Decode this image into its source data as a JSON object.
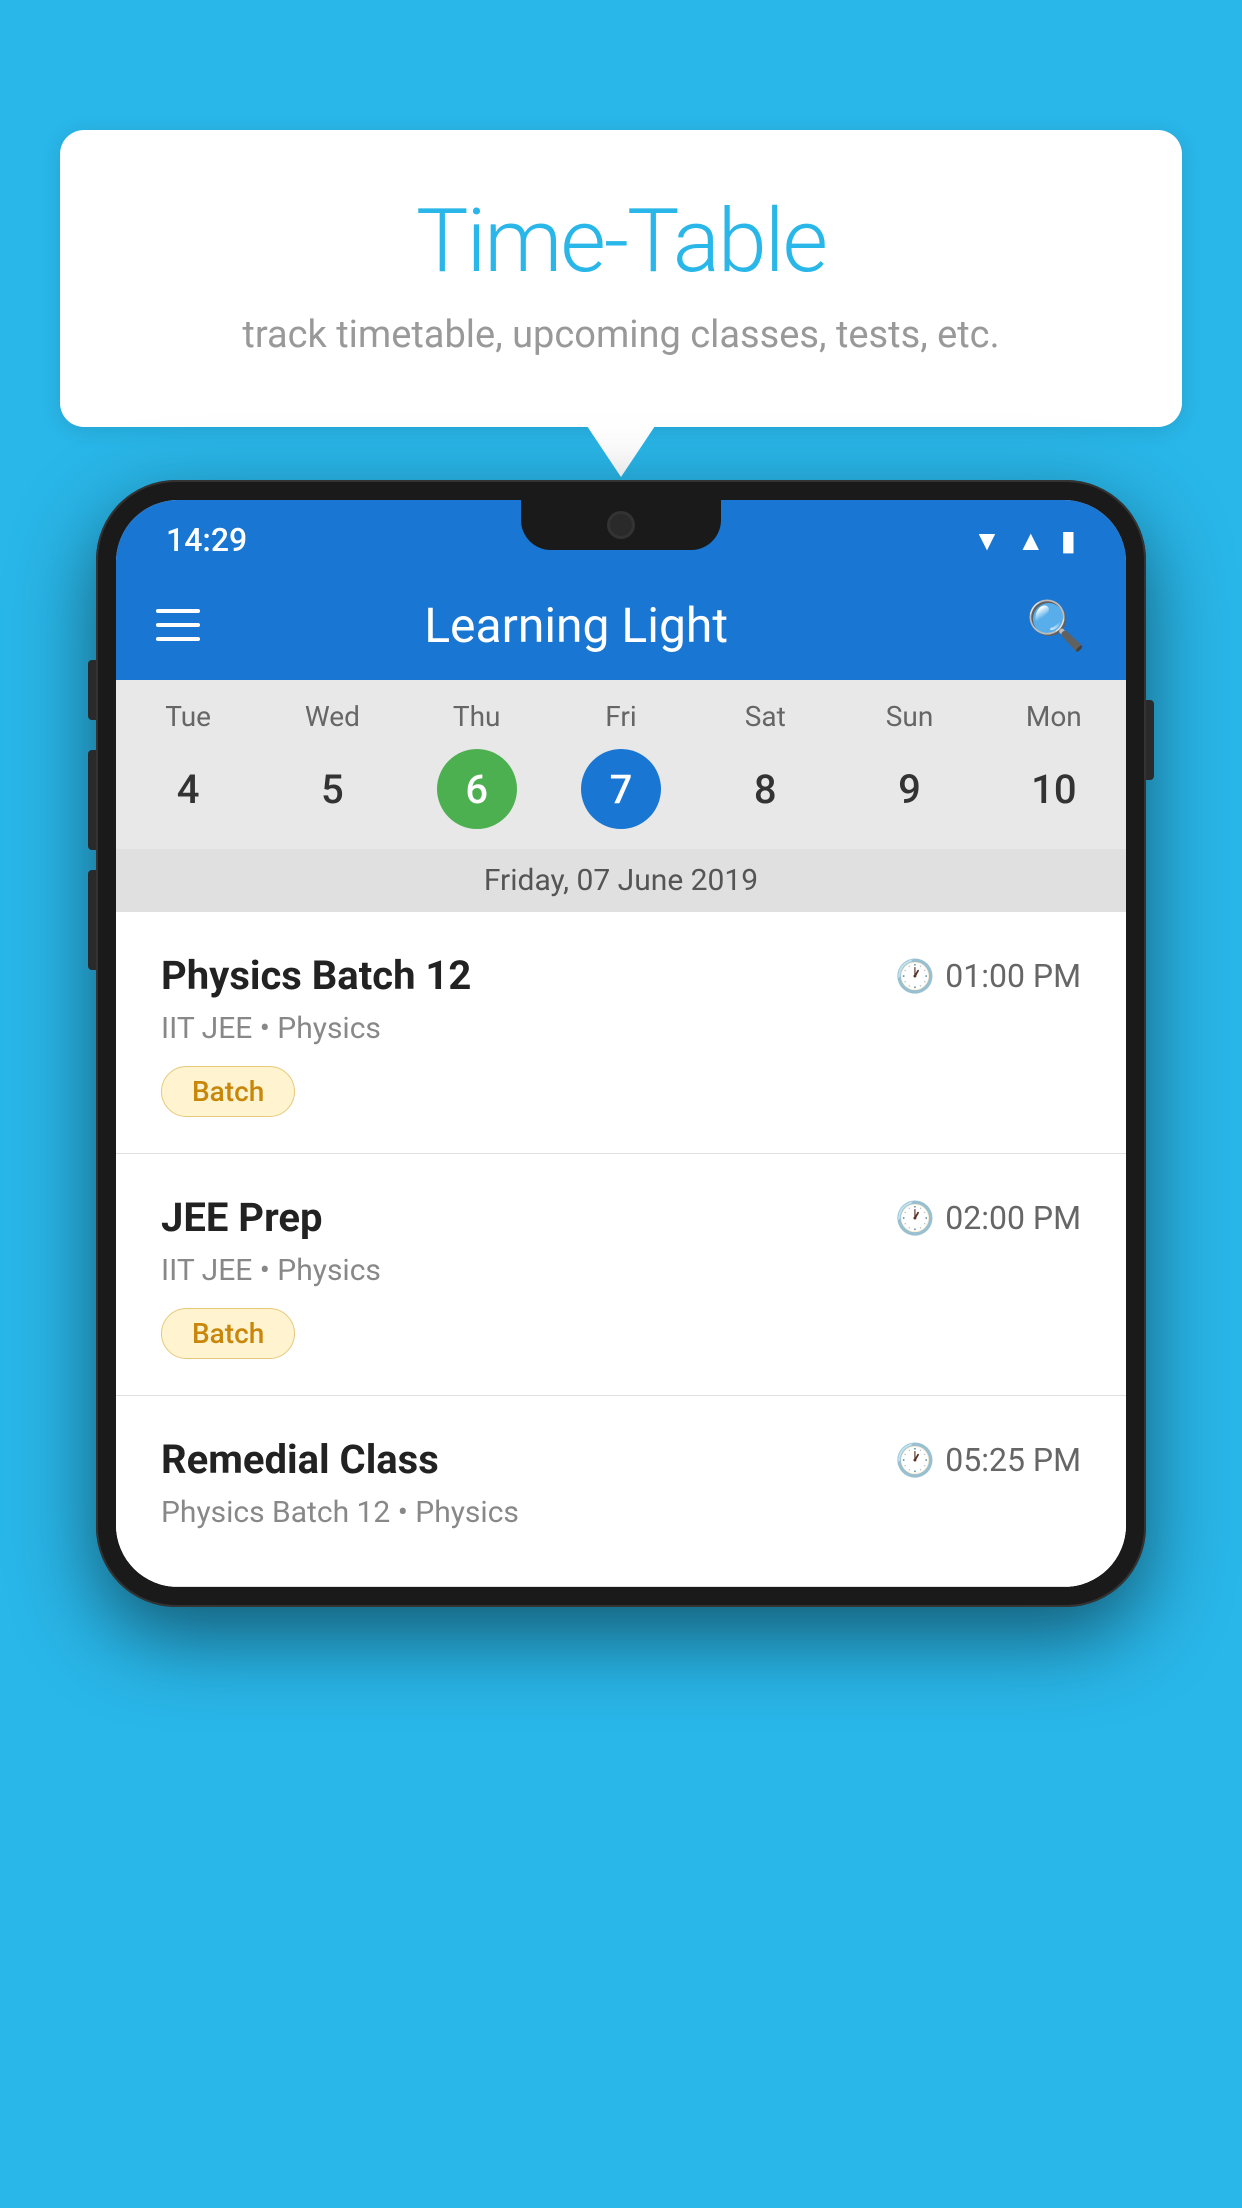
{
  "background_color": "#29b6e8",
  "bubble": {
    "title": "Time-Table",
    "subtitle": "track timetable, upcoming classes, tests, etc."
  },
  "status_bar": {
    "time": "14:29"
  },
  "app_bar": {
    "title": "Learning Light"
  },
  "calendar": {
    "days": [
      {
        "name": "Tue",
        "num": "4",
        "state": "normal"
      },
      {
        "name": "Wed",
        "num": "5",
        "state": "normal"
      },
      {
        "name": "Thu",
        "num": "6",
        "state": "today"
      },
      {
        "name": "Fri",
        "num": "7",
        "state": "selected"
      },
      {
        "name": "Sat",
        "num": "8",
        "state": "normal"
      },
      {
        "name": "Sun",
        "num": "9",
        "state": "normal"
      },
      {
        "name": "Mon",
        "num": "10",
        "state": "normal"
      }
    ],
    "selected_date": "Friday, 07 June 2019"
  },
  "schedule": {
    "items": [
      {
        "title": "Physics Batch 12",
        "time": "01:00 PM",
        "sub": "IIT JEE • Physics",
        "badge": "Batch"
      },
      {
        "title": "JEE Prep",
        "time": "02:00 PM",
        "sub": "IIT JEE • Physics",
        "badge": "Batch"
      },
      {
        "title": "Remedial Class",
        "time": "05:25 PM",
        "sub": "Physics Batch 12 • Physics",
        "badge": null
      }
    ]
  },
  "icons": {
    "hamburger": "☰",
    "search": "🔍",
    "clock": "⏱"
  }
}
